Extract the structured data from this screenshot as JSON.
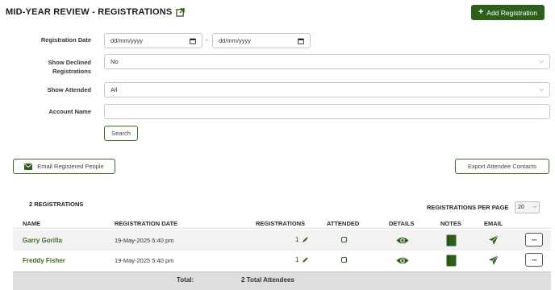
{
  "page": {
    "title": "MID-YEAR REVIEW - REGISTRATIONS"
  },
  "toolbar": {
    "add_label": "Add Registration"
  },
  "filters": {
    "registration_date_label": "Registration Date",
    "date_from_placeholder": "dd/mm/yyyy",
    "date_separator": "-",
    "date_to_placeholder": "dd/mm/yyyy",
    "show_declined_label_line1": "Show Declined",
    "show_declined_label_line2": "Registrations",
    "show_declined_value": "No",
    "show_attended_label": "Show Attended",
    "show_attended_value": "All",
    "account_name_label": "Account Name",
    "account_name_value": "",
    "search_label": "Search"
  },
  "actions": {
    "email_registered_label": "Email Registered People",
    "export_contacts_label": "Export Attendee Contacts"
  },
  "table": {
    "count_label": "2 REGISTRATIONS",
    "per_page_label": "REGISTRATIONS PER PAGE",
    "per_page_value": "20",
    "columns": {
      "name": "NAME",
      "registration_date": "REGISTRATION DATE",
      "registrations": "REGISTRATIONS",
      "attended": "ATTENDED",
      "details": "DETAILS",
      "notes": "NOTES",
      "email": "EMAIL"
    },
    "rows": [
      {
        "name": "Garry Gorilla",
        "date": "19-May-2025 5:40 pm",
        "registrations": "1",
        "more": "···"
      },
      {
        "name": "Freddy Fisher",
        "date": "19-May-2025 5:40 pm",
        "registrations": "1",
        "more": "···"
      }
    ],
    "total_label": "Total:",
    "total_value": "2 Total Attendees"
  },
  "colors": {
    "accent": "#2e5e1c",
    "link": "#3d6b27",
    "row_alt": "#f2f2f2",
    "total_bar": "#dedede"
  },
  "icons": [
    "external-link-icon",
    "plus-icon",
    "calendar-icon",
    "chevron-down-icon",
    "envelope-icon",
    "pencil-icon",
    "eye-icon",
    "book-icon",
    "paper-plane-icon"
  ]
}
